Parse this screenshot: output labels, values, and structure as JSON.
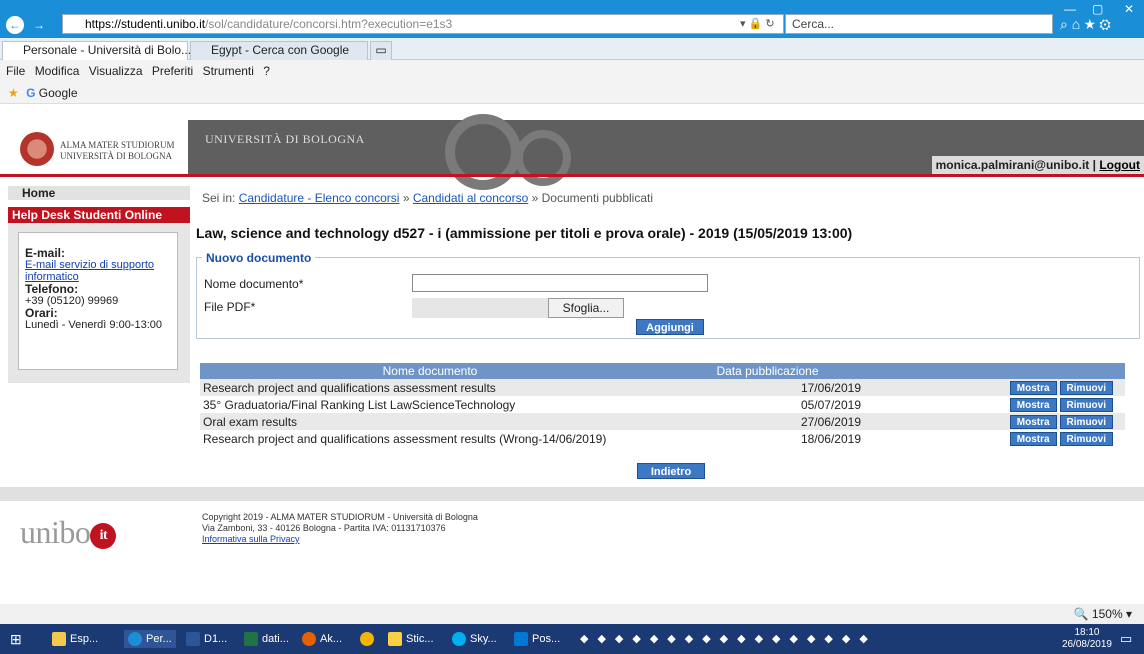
{
  "browser": {
    "url_host": "https://studenti.unibo.it",
    "url_path": "/sol/candidature/concorsi.htm?execution=e1s3",
    "search_placeholder": "Cerca...",
    "tabs": [
      "Personale - Università di Bolo...",
      "Egypt - Cerca con Google"
    ],
    "menu": [
      "File",
      "Modifica",
      "Visualizza",
      "Preferiti",
      "Strumenti",
      "?"
    ],
    "favorites": [
      "Google"
    ],
    "zoom": "150%"
  },
  "header": {
    "logo_line1": "ALMA MATER STUDIORUM",
    "logo_line2": "UNIVERSITÀ DI BOLOGNA",
    "title": "UNIVERSITÀ DI BOLOGNA",
    "user": "monica.palmirani@unibo.it",
    "separator": "|",
    "logout": "Logout"
  },
  "sidebar": {
    "home": "Home",
    "helpdesk": "Help Desk Studenti Online",
    "email_label": "E-mail:",
    "email_link": "E-mail servizio di supporto informatico",
    "phone_label": "Telefono:",
    "phone": "+39 (05120) 99969",
    "hours_label": "Orari:",
    "hours": "Lunedì - Venerdì 9:00-13:00"
  },
  "breadcrumb": {
    "prefix": "Sei in:",
    "item1": "Candidature - Elenco concorsi",
    "sep": "»",
    "item2": "Candidati al concorso",
    "current": "Documenti pubblicati"
  },
  "page_title": "Law, science and technology d527 - i (ammissione per titoli e prova orale) - 2019 (15/05/2019 13:00)",
  "form": {
    "legend": "Nuovo documento",
    "name_label": "Nome documento*",
    "file_label": "File PDF*",
    "browse": "Sfoglia...",
    "add": "Aggiungi"
  },
  "table": {
    "headers": [
      "Nome documento",
      "Data pubblicazione"
    ],
    "rows": [
      {
        "name": "Research project and qualifications assessment results",
        "date": "17/06/2019"
      },
      {
        "name": "35° Graduatoria/Final Ranking List LawScienceTechnology",
        "date": "05/07/2019"
      },
      {
        "name": "Oral exam results",
        "date": "27/06/2019"
      },
      {
        "name": "Research project and qualifications assessment results (Wrong-14/06/2019)",
        "date": "18/06/2019"
      }
    ],
    "show_label": "Mostra",
    "remove_label": "Rimuovi",
    "back": "Indietro"
  },
  "footer": {
    "logo_text": "unibo",
    "logo_dot": "it",
    "line1": "Copyright 2019 - ALMA MATER STUDIORUM - Università di Bologna",
    "line2": "Via Zamboni, 33 - 40126 Bologna - Partita IVA: 01131710376",
    "privacy": "Informativa sulla Privacy"
  },
  "taskbar": {
    "items": [
      "Esp...",
      "Per...",
      "D1...",
      "dati...",
      "Ak...",
      "Stic...",
      "Sky...",
      "Pos..."
    ],
    "time": "18:10",
    "date": "26/08/2019"
  },
  "colors": {
    "brand_red": "#c1121f",
    "header_gray": "#5f5f5f",
    "button_blue": "#3c78c3",
    "browser_blue": "#1a8fd8"
  }
}
